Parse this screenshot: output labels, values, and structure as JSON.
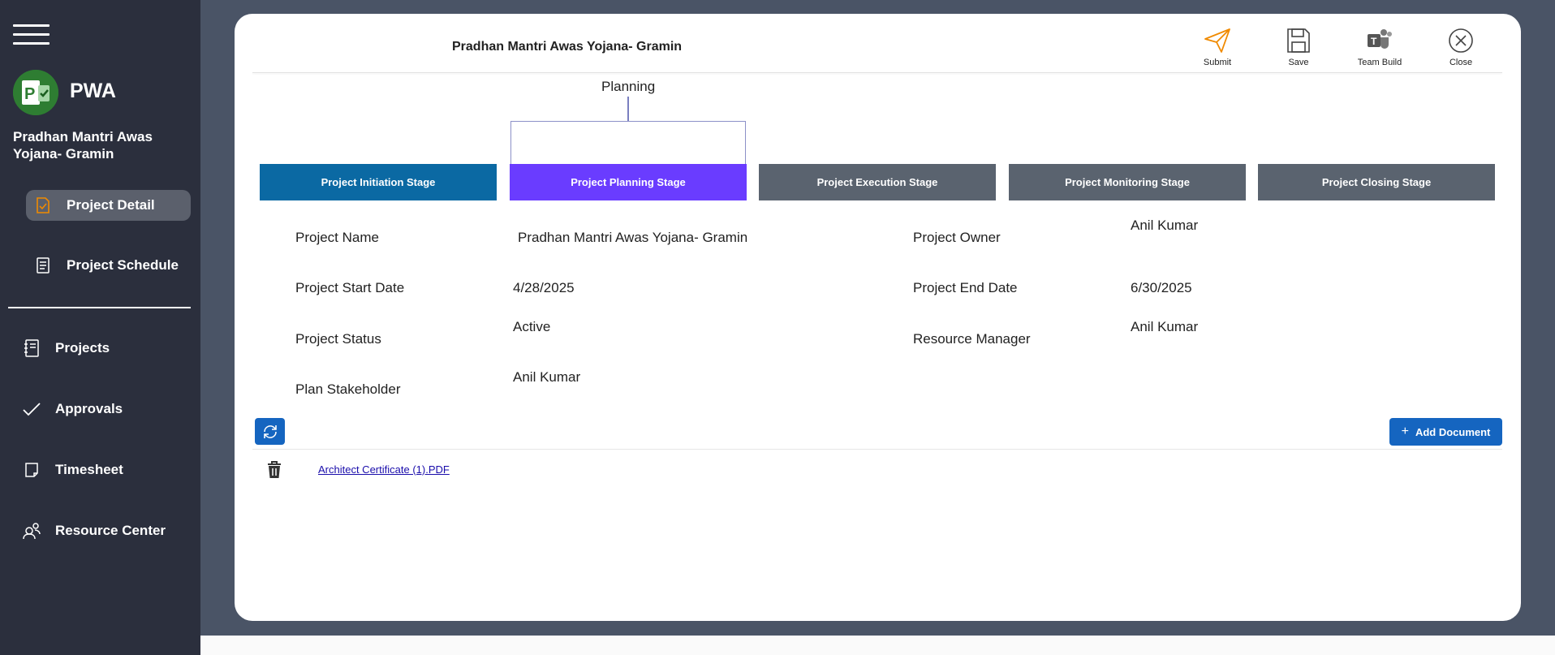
{
  "sidebar": {
    "app_name": "PWA",
    "project_title": "Pradhan Mantri Awas Yojana- Gramin",
    "items": [
      {
        "label": "Project Detail",
        "icon": "document-check-icon"
      },
      {
        "label": "Project Schedule",
        "icon": "schedule-icon"
      },
      {
        "label": "Projects",
        "icon": "notebook-icon"
      },
      {
        "label": "Approvals",
        "icon": "checkmark-icon"
      },
      {
        "label": "Timesheet",
        "icon": "timesheet-icon"
      },
      {
        "label": "Resource Center",
        "icon": "people-icon"
      }
    ]
  },
  "header": {
    "title": "Pradhan Mantri Awas Yojana- Gramin",
    "tools": [
      {
        "label": "Submit",
        "icon": "send-icon"
      },
      {
        "label": "Save",
        "icon": "save-icon"
      },
      {
        "label": "Team Build",
        "icon": "teams-icon"
      },
      {
        "label": "Close",
        "icon": "close-icon"
      }
    ]
  },
  "current_phase": "Planning",
  "stages": [
    {
      "label": "Project Initiation Stage",
      "color": "#0b69a3"
    },
    {
      "label": "Project Planning Stage",
      "color": "#6a3cff"
    },
    {
      "label": "Project Execution Stage",
      "color": "#5a636f"
    },
    {
      "label": "Project Monitoring Stage",
      "color": "#5a636f"
    },
    {
      "label": "Project Closing Stage",
      "color": "#5a636f"
    }
  ],
  "fields": {
    "project_name": {
      "label": "Project Name",
      "value": "Pradhan Mantri Awas Yojana- Gramin"
    },
    "project_owner": {
      "label": "Project Owner",
      "value": "Anil Kumar"
    },
    "start_date": {
      "label": "Project Start Date",
      "value": "4/28/2025"
    },
    "end_date": {
      "label": "Project End Date",
      "value": "6/30/2025"
    },
    "status": {
      "label": "Project Status",
      "value": "Active"
    },
    "resource_manager": {
      "label": "Resource Manager",
      "value": "Anil Kumar"
    },
    "stakeholder": {
      "label": "Plan Stakeholder",
      "value": "Anil Kumar"
    }
  },
  "documents": {
    "add_label": "Add Document",
    "items": [
      {
        "name": "Architect Certificate (1).PDF"
      }
    ]
  },
  "colors": {
    "sidebar_bg": "#2b2f3d",
    "page_bg": "#4a5466",
    "accent_blue": "#1565c0",
    "submit_orange": "#f08a00"
  }
}
